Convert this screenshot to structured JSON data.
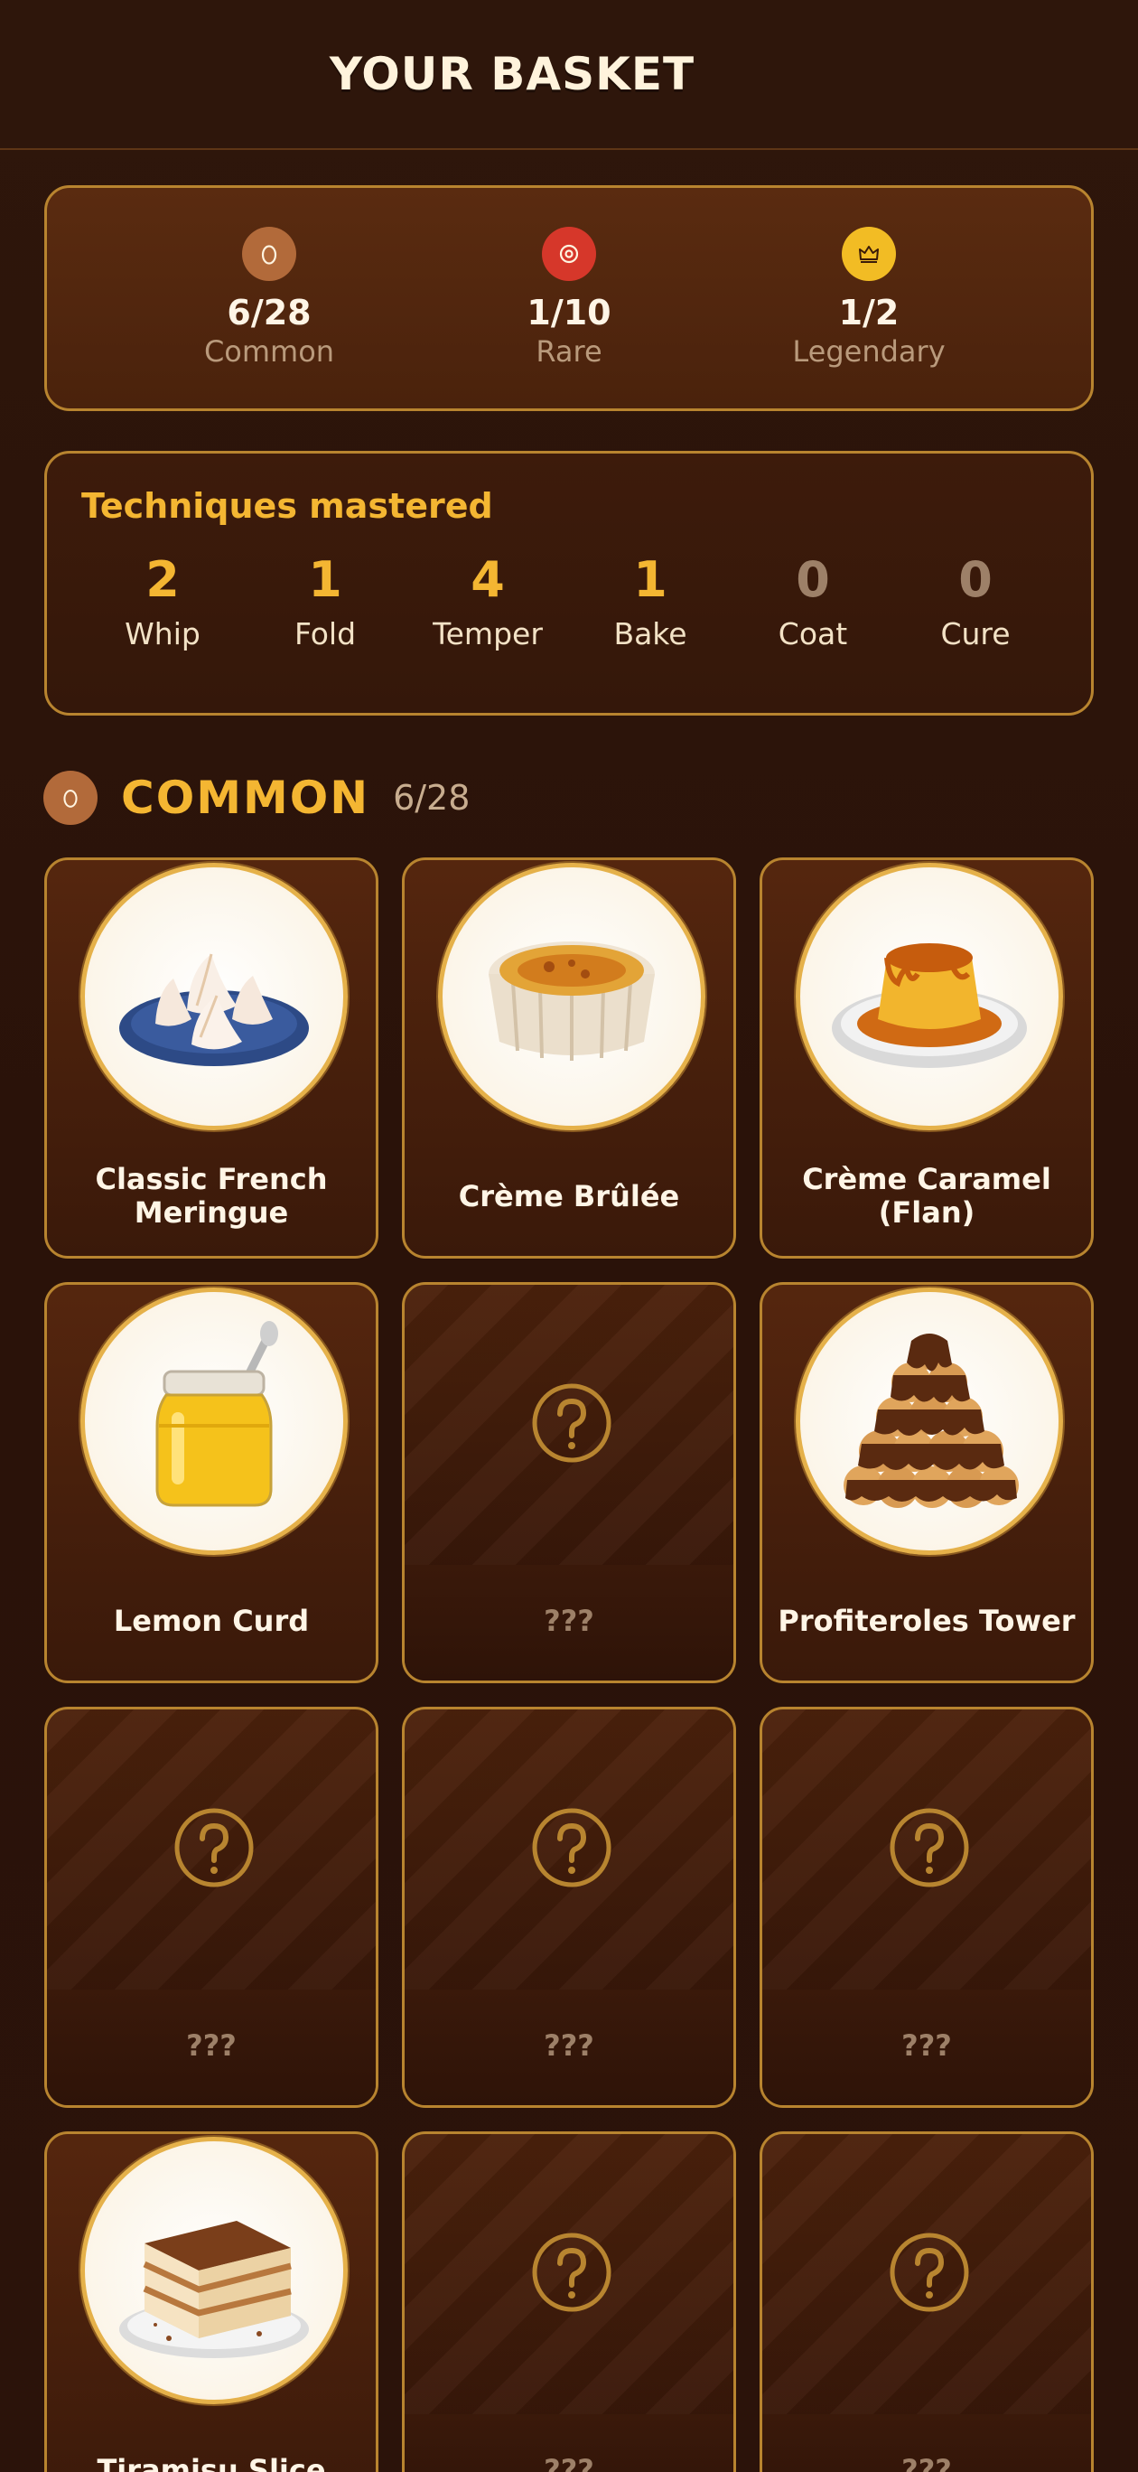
{
  "header": {
    "title": "YOUR BASKET"
  },
  "rarity_stats": [
    {
      "value": "6/28",
      "label": "Common",
      "icon": "egg-icon",
      "color": "#b26a3a"
    },
    {
      "value": "1/10",
      "label": "Rare",
      "icon": "flower-icon",
      "color": "#d6372a"
    },
    {
      "value": "1/2",
      "label": "Legendary",
      "icon": "crown-icon",
      "color": "#f2bc24"
    }
  ],
  "techniques": {
    "title": "Techniques mastered",
    "items": [
      {
        "count": "2",
        "name": "Whip"
      },
      {
        "count": "1",
        "name": "Fold"
      },
      {
        "count": "4",
        "name": "Temper"
      },
      {
        "count": "1",
        "name": "Bake"
      },
      {
        "count": "0",
        "name": "Coat"
      },
      {
        "count": "0",
        "name": "Cure"
      }
    ]
  },
  "section": {
    "title": "COMMON",
    "count": "6/28",
    "icon": "egg-icon"
  },
  "cards": [
    {
      "name": "Classic French Meringue",
      "unlocked": true,
      "icon": "meringue-icon"
    },
    {
      "name": "Crème Brûlée",
      "unlocked": true,
      "icon": "creme-brulee-icon"
    },
    {
      "name": "Crème Caramel (Flan)",
      "unlocked": true,
      "icon": "flan-icon"
    },
    {
      "name": "Lemon Curd",
      "unlocked": true,
      "icon": "lemon-curd-icon"
    },
    {
      "name": "???",
      "unlocked": false,
      "icon": "question-icon"
    },
    {
      "name": "Profiteroles Tower",
      "unlocked": true,
      "icon": "profiteroles-icon"
    },
    {
      "name": "???",
      "unlocked": false,
      "icon": "question-icon"
    },
    {
      "name": "???",
      "unlocked": false,
      "icon": "question-icon"
    },
    {
      "name": "???",
      "unlocked": false,
      "icon": "question-icon"
    },
    {
      "name": "Tiramisu Slice",
      "unlocked": true,
      "icon": "tiramisu-icon"
    },
    {
      "name": "???",
      "unlocked": false,
      "icon": "question-icon"
    },
    {
      "name": "???",
      "unlocked": false,
      "icon": "question-icon"
    }
  ],
  "colors": {
    "accent": "#f4b632",
    "border": "#b8842f",
    "background": "#2a140a"
  }
}
